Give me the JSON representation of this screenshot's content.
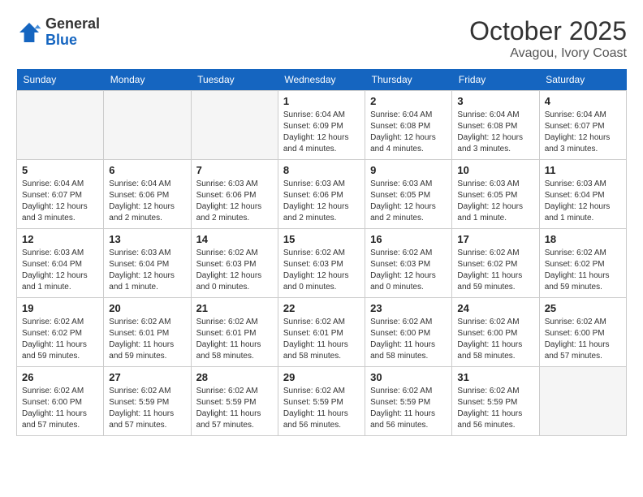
{
  "header": {
    "logo_line1": "General",
    "logo_line2": "Blue",
    "month": "October 2025",
    "location": "Avagou, Ivory Coast"
  },
  "days_of_week": [
    "Sunday",
    "Monday",
    "Tuesday",
    "Wednesday",
    "Thursday",
    "Friday",
    "Saturday"
  ],
  "weeks": [
    [
      {
        "day": "",
        "info": ""
      },
      {
        "day": "",
        "info": ""
      },
      {
        "day": "",
        "info": ""
      },
      {
        "day": "1",
        "info": "Sunrise: 6:04 AM\nSunset: 6:09 PM\nDaylight: 12 hours and 4 minutes."
      },
      {
        "day": "2",
        "info": "Sunrise: 6:04 AM\nSunset: 6:08 PM\nDaylight: 12 hours and 4 minutes."
      },
      {
        "day": "3",
        "info": "Sunrise: 6:04 AM\nSunset: 6:08 PM\nDaylight: 12 hours and 3 minutes."
      },
      {
        "day": "4",
        "info": "Sunrise: 6:04 AM\nSunset: 6:07 PM\nDaylight: 12 hours and 3 minutes."
      }
    ],
    [
      {
        "day": "5",
        "info": "Sunrise: 6:04 AM\nSunset: 6:07 PM\nDaylight: 12 hours and 3 minutes."
      },
      {
        "day": "6",
        "info": "Sunrise: 6:04 AM\nSunset: 6:06 PM\nDaylight: 12 hours and 2 minutes."
      },
      {
        "day": "7",
        "info": "Sunrise: 6:03 AM\nSunset: 6:06 PM\nDaylight: 12 hours and 2 minutes."
      },
      {
        "day": "8",
        "info": "Sunrise: 6:03 AM\nSunset: 6:06 PM\nDaylight: 12 hours and 2 minutes."
      },
      {
        "day": "9",
        "info": "Sunrise: 6:03 AM\nSunset: 6:05 PM\nDaylight: 12 hours and 2 minutes."
      },
      {
        "day": "10",
        "info": "Sunrise: 6:03 AM\nSunset: 6:05 PM\nDaylight: 12 hours and 1 minute."
      },
      {
        "day": "11",
        "info": "Sunrise: 6:03 AM\nSunset: 6:04 PM\nDaylight: 12 hours and 1 minute."
      }
    ],
    [
      {
        "day": "12",
        "info": "Sunrise: 6:03 AM\nSunset: 6:04 PM\nDaylight: 12 hours and 1 minute."
      },
      {
        "day": "13",
        "info": "Sunrise: 6:03 AM\nSunset: 6:04 PM\nDaylight: 12 hours and 1 minute."
      },
      {
        "day": "14",
        "info": "Sunrise: 6:02 AM\nSunset: 6:03 PM\nDaylight: 12 hours and 0 minutes."
      },
      {
        "day": "15",
        "info": "Sunrise: 6:02 AM\nSunset: 6:03 PM\nDaylight: 12 hours and 0 minutes."
      },
      {
        "day": "16",
        "info": "Sunrise: 6:02 AM\nSunset: 6:03 PM\nDaylight: 12 hours and 0 minutes."
      },
      {
        "day": "17",
        "info": "Sunrise: 6:02 AM\nSunset: 6:02 PM\nDaylight: 11 hours and 59 minutes."
      },
      {
        "day": "18",
        "info": "Sunrise: 6:02 AM\nSunset: 6:02 PM\nDaylight: 11 hours and 59 minutes."
      }
    ],
    [
      {
        "day": "19",
        "info": "Sunrise: 6:02 AM\nSunset: 6:02 PM\nDaylight: 11 hours and 59 minutes."
      },
      {
        "day": "20",
        "info": "Sunrise: 6:02 AM\nSunset: 6:01 PM\nDaylight: 11 hours and 59 minutes."
      },
      {
        "day": "21",
        "info": "Sunrise: 6:02 AM\nSunset: 6:01 PM\nDaylight: 11 hours and 58 minutes."
      },
      {
        "day": "22",
        "info": "Sunrise: 6:02 AM\nSunset: 6:01 PM\nDaylight: 11 hours and 58 minutes."
      },
      {
        "day": "23",
        "info": "Sunrise: 6:02 AM\nSunset: 6:00 PM\nDaylight: 11 hours and 58 minutes."
      },
      {
        "day": "24",
        "info": "Sunrise: 6:02 AM\nSunset: 6:00 PM\nDaylight: 11 hours and 58 minutes."
      },
      {
        "day": "25",
        "info": "Sunrise: 6:02 AM\nSunset: 6:00 PM\nDaylight: 11 hours and 57 minutes."
      }
    ],
    [
      {
        "day": "26",
        "info": "Sunrise: 6:02 AM\nSunset: 6:00 PM\nDaylight: 11 hours and 57 minutes."
      },
      {
        "day": "27",
        "info": "Sunrise: 6:02 AM\nSunset: 5:59 PM\nDaylight: 11 hours and 57 minutes."
      },
      {
        "day": "28",
        "info": "Sunrise: 6:02 AM\nSunset: 5:59 PM\nDaylight: 11 hours and 57 minutes."
      },
      {
        "day": "29",
        "info": "Sunrise: 6:02 AM\nSunset: 5:59 PM\nDaylight: 11 hours and 56 minutes."
      },
      {
        "day": "30",
        "info": "Sunrise: 6:02 AM\nSunset: 5:59 PM\nDaylight: 11 hours and 56 minutes."
      },
      {
        "day": "31",
        "info": "Sunrise: 6:02 AM\nSunset: 5:59 PM\nDaylight: 11 hours and 56 minutes."
      },
      {
        "day": "",
        "info": ""
      }
    ]
  ]
}
